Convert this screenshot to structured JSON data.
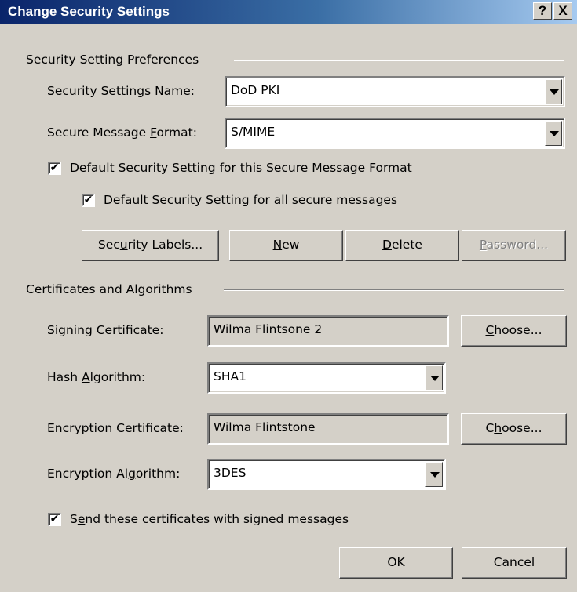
{
  "window": {
    "title": "Change Security Settings",
    "help_glyph": "?",
    "close_glyph": "X"
  },
  "preferences": {
    "group_label": "Security Setting Preferences",
    "settings_name_label": "Security Settings Name:",
    "settings_name_value": "DoD PKI",
    "format_label": "Secure Message Format:",
    "format_value": "S/MIME",
    "default_format_label": "Default Security Setting for this Secure Message Format",
    "default_format_checked": true,
    "default_all_label": "Default Security Setting for all secure messages",
    "default_all_checked": true,
    "buttons": {
      "security_labels": "Security Labels...",
      "new": "New",
      "delete": "Delete",
      "password": "Password..."
    }
  },
  "certificates": {
    "group_label": "Certificates and Algorithms",
    "signing_cert_label": "Signing Certificate:",
    "signing_cert_value": "Wilma Flintsone 2",
    "hash_label": "Hash Algorithm:",
    "hash_value": "SHA1",
    "encryption_cert_label": "Encryption Certificate:",
    "encryption_cert_value": "Wilma Flintstone",
    "encryption_alg_label": "Encryption Algorithm:",
    "encryption_alg_value": "3DES",
    "choose_label": "Choose...",
    "send_certs_label": "Send these certificates with signed messages",
    "send_certs_checked": true
  },
  "footer": {
    "ok": "OK",
    "cancel": "Cancel"
  },
  "icons": {
    "check": "✔",
    "dropdown": "chevron-down-icon"
  }
}
